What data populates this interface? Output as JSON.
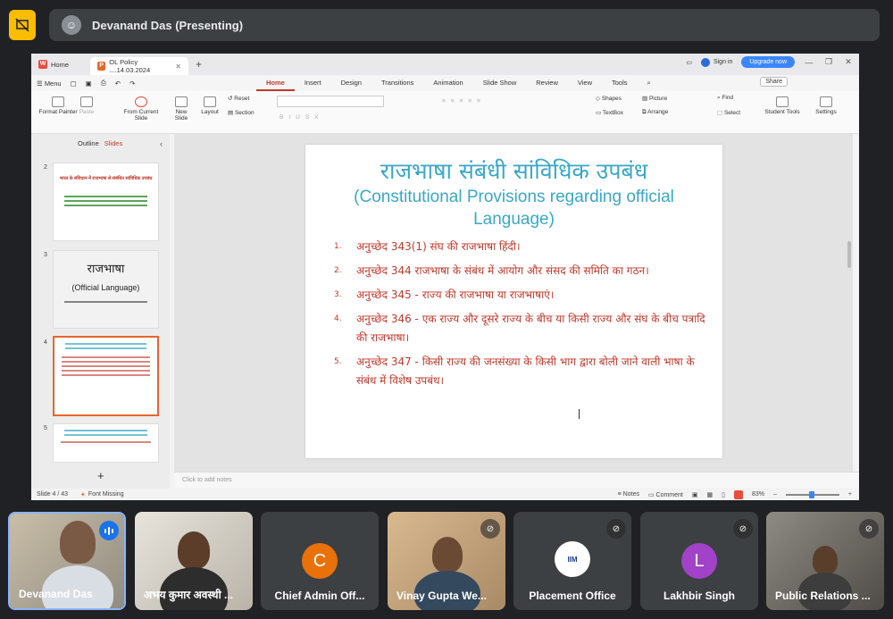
{
  "meet": {
    "presenter_label": "Devanand Das (Presenting)"
  },
  "wps": {
    "home_tab": "Home",
    "doc_tab": "OL Policy ....14.03.2024",
    "sign_in": "Sign in",
    "upgrade": "Upgrade now",
    "menu_label": "Menu",
    "menu_tabs": [
      "Home",
      "Insert",
      "Design",
      "Transitions",
      "Animation",
      "Slide Show",
      "Review",
      "View",
      "Tools"
    ],
    "share": "Share",
    "ribbon": {
      "format_painter": "Format Painter",
      "paste": "Paste",
      "from_current_slide": "From Current Slide",
      "new_slide": "New Slide",
      "layout": "Layout",
      "reset": "Reset",
      "section": "Section",
      "shapes": "Shapes",
      "picture": "Picture",
      "textbox": "TextBox",
      "arrange": "Arrange",
      "find": "Find",
      "select": "Select",
      "student_tools": "Student Tools",
      "settings": "Settings"
    },
    "panel": {
      "outline": "Outline",
      "slides": "Slides",
      "thumb_numbers": [
        "2",
        "3",
        "4",
        "5"
      ],
      "thumb2_title": "भारत के संविधान में राजभाषा से संबंधित सांविधिक उपबंध",
      "thumb3_title": "राजभाषा",
      "thumb3_sub": "(Official Language)"
    },
    "slide": {
      "title_hi": "राजभाषा संबंधी सांविधिक उपबंध",
      "title_en": "(Constitutional Provisions regarding official Language)",
      "items": [
        {
          "num": "1.",
          "text": "अनुच्छेद 343(1) संघ की राजभाषा हिंदी।"
        },
        {
          "num": "2.",
          "text": "अनुच्छेद 344  राजभाषा के संबंध में आयोग और संसद की समिति का गठन।"
        },
        {
          "num": "3.",
          "text": "अनुच्छेद 345  -  राज्य की राजभाषा या राजभाषाएं।"
        },
        {
          "num": "4.",
          "text": "अनुच्छेद 346  -  एक राज्य और दूसरे राज्य के बीच या किसी राज्य और संघ के बीच पत्रादि की राजभाषा।"
        },
        {
          "num": "5.",
          "text": "अनुच्छेद 347  -  किसी राज्य की जनसंख्या के किसी भाग द्वारा बोली जाने वाली भाषा के संबंध में विशेष उपबंध।"
        }
      ]
    },
    "notes_placeholder": "Click to add notes",
    "status": {
      "slide_count": "Slide 4 / 43",
      "font_missing": "Font Missing",
      "notes": "Notes",
      "comment": "Comment",
      "zoom": "83%"
    }
  },
  "participants": [
    {
      "name": "Devanand Das"
    },
    {
      "name": "अभय कुमार अवस्थी ..."
    },
    {
      "name": "Chief Admin Off...",
      "initial": "C",
      "color": "#e8710a"
    },
    {
      "name": "Vinay Gupta We..."
    },
    {
      "name": "Placement Office",
      "logo_text": "IIM"
    },
    {
      "name": "Lakhbir Singh",
      "initial": "L",
      "color": "#a142c9"
    },
    {
      "name": "Public Relations ..."
    }
  ]
}
